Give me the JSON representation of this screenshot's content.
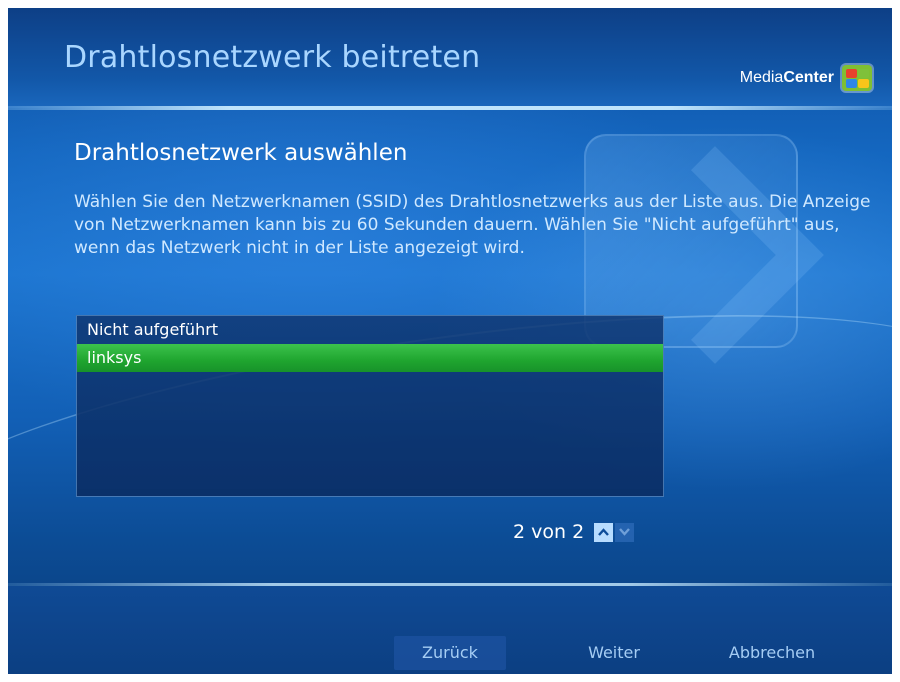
{
  "header": {
    "title": "Drahtlosnetzwerk beitreten",
    "brand_part1": "Media",
    "brand_part2": "Center",
    "brand_icon": "windows-flag-icon"
  },
  "main": {
    "section_title": "Drahtlosnetzwerk auswählen",
    "description": "Wählen Sie den Netzwerknamen (SSID) des Drahtlosnetzwerks aus der Liste aus. Die Anzeige von Netzwerknamen kann bis zu 60 Sekunden dauern. Wählen Sie \"Nicht aufgeführt\" aus, wenn das Netzwerk nicht in der Liste angezeigt wird.",
    "networks": [
      {
        "label": "Nicht aufgeführt",
        "selected": false
      },
      {
        "label": "linksys",
        "selected": true
      }
    ],
    "pager": {
      "text": "2 von 2",
      "up_icon": "chevron-up-icon",
      "down_icon": "chevron-down-icon"
    }
  },
  "footer": {
    "back_label": "Zurück",
    "next_label": "Weiter",
    "cancel_label": "Abbrechen"
  },
  "colors": {
    "selection": "#1fa52f",
    "title": "#a9d6ff",
    "background": "#1467c0"
  }
}
